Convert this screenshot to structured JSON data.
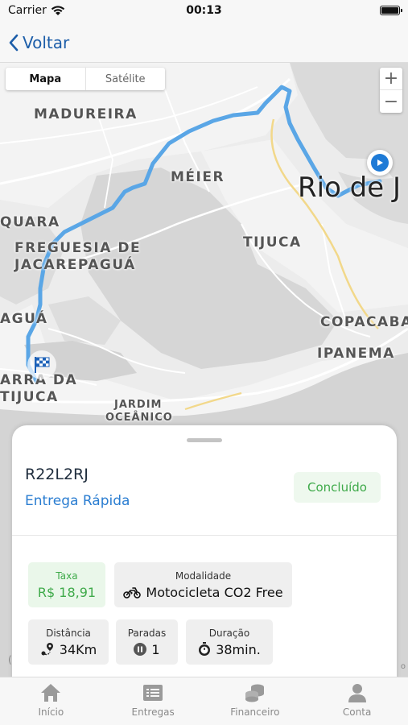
{
  "status_bar": {
    "carrier": "Carrier",
    "time": "00:13"
  },
  "nav": {
    "back_label": "Voltar"
  },
  "map": {
    "type_toggle": {
      "map_label": "Mapa",
      "satellite_label": "Satélite",
      "selected": "Mapa"
    },
    "labels": {
      "madureira": "MADUREIRA",
      "meier": "MÉIER",
      "quara": "QUARA",
      "freguesia_1": "FREGUESIA DE",
      "freguesia_2": "JACAREPAGUÁ",
      "tijuca": "TIJUCA",
      "rio": "Rio de J",
      "agua": "AGUÁ",
      "copacabana": "COPACABA",
      "ipanema": "IPANEMA",
      "barra_1": "ARRA DA",
      "barra_2": "TIJUCA",
      "jardim_1": "JARDIM",
      "jardim_2": "OCEÂNICO"
    },
    "zoom_in": "+",
    "zoom_out": "−",
    "route_color": "#5aa6e6",
    "start_icon": "play-icon",
    "end_icon": "checkered-flag-icon"
  },
  "order": {
    "code": "R22L2RJ",
    "type": "Entrega Rápida",
    "status": "Concluído",
    "fee": {
      "label": "Taxa",
      "value": "R$ 18,91"
    },
    "modality": {
      "label": "Modalidade",
      "value": "Motocicleta CO2 Free",
      "icon": "motorcycle-icon"
    },
    "distance": {
      "label": "Distância",
      "value": "34Km",
      "icon": "route-pin-icon"
    },
    "stops": {
      "label": "Paradas",
      "value": "1",
      "icon": "pause-icon"
    },
    "duration": {
      "label": "Duração",
      "value": "38min.",
      "icon": "stopwatch-icon"
    }
  },
  "tabs": [
    {
      "label": "Início",
      "icon": "home-icon"
    },
    {
      "label": "Entregas",
      "icon": "list-icon"
    },
    {
      "label": "Financeiro",
      "icon": "coins-icon"
    },
    {
      "label": "Conta",
      "icon": "user-icon"
    }
  ],
  "colors": {
    "accent_blue": "#1d5ea9",
    "link_blue": "#2a7dd1",
    "success_green": "#3faa4a"
  }
}
